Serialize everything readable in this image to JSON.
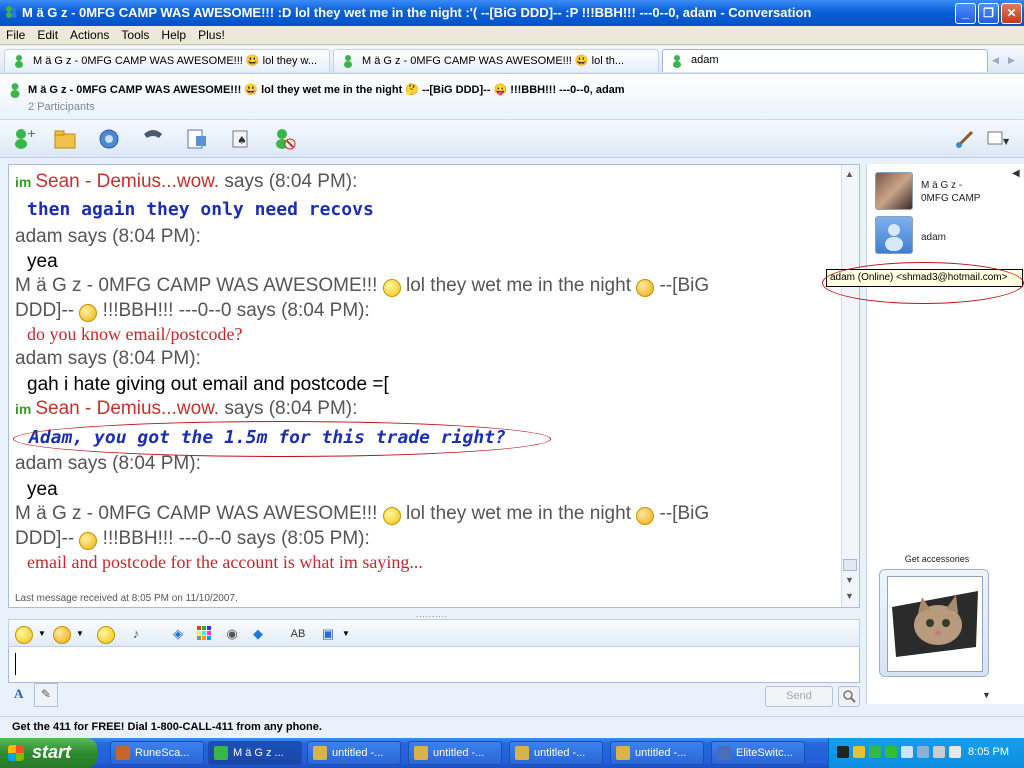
{
  "window": {
    "title": "M ä G z -      0MFG CAMP WAS AWESOME!!! :D lol they wet me in the night :'( --[BiG DDD]--     :P !!!BBH!!! ---0--0, adam - Conversation",
    "minimize": "_",
    "maximize": "❐",
    "close": "✕"
  },
  "menu": [
    "File",
    "Edit",
    "Actions",
    "Tools",
    "Help",
    "Plus!"
  ],
  "tabs": [
    {
      "label": "M ä G z -      0MFG CAMP WAS AWESOME!!! 😃 lol they w..."
    },
    {
      "label": "M ä G z -      0MFG CAMP WAS AWESOME!!! 😃 lol th..."
    },
    {
      "label": "adam"
    }
  ],
  "participants": {
    "names": "M ä G z -      0MFG CAMP WAS AWESOME!!! 😃 lol they wet me in the night 🤔 --[BiG DDD]--     😛 !!!BBH!!! ---0--0, adam",
    "count": "2 Participants"
  },
  "toolbar_icons": [
    "invite-contact-icon",
    "send-files-icon",
    "video-call-icon",
    "voice-call-icon",
    "activities-icon",
    "games-icon",
    "block-contact-icon",
    "paintbrush-icon",
    "display-options-icon"
  ],
  "messages": [
    {
      "im": "im",
      "sender": "Sean - Demius...wow.",
      "says": " says (8:04 PM):",
      "body": "then again they only need recovs"
    },
    {
      "sender": "adam",
      "says": " says (8:04 PM):",
      "body": "yea"
    },
    {
      "sender_a": "M ä  G z -      0MFG CAMP WAS AWESOME!!! ",
      "sender_b": " lol they wet me in the night ",
      "sender_c": " --[BiG",
      "sender_d": "DDD]--     ",
      "sender_e": " !!!BBH!!! ---0--0 says (8:04 PM):",
      "body": "do you know email/postcode?"
    },
    {
      "sender": "adam",
      "says": " says (8:04 PM):",
      "body": "gah i hate giving out email and postcode =["
    },
    {
      "im": "im",
      "sender": "Sean - Demius...wow.",
      "says": " says (8:04 PM):",
      "body": "Adam, you got the 1.5m for this trade right?"
    },
    {
      "sender": "adam",
      "says": " says (8:04 PM):",
      "body": "yea"
    },
    {
      "sender_a": "M ä  G z -      0MFG CAMP WAS AWESOME!!! ",
      "sender_b": " lol they wet me in the night ",
      "sender_c": " --[BiG",
      "sender_d": "DDD]--     ",
      "sender_e": " !!!BBH!!! ---0--0 says (8:05 PM):",
      "body": "email and postcode for the account is what im saying..."
    }
  ],
  "last_message": "Last message received at 8:05 PM on 11/10/2007.",
  "splitter": "..........",
  "input": {
    "send_label": "Send"
  },
  "contacts": [
    {
      "line1": "M ä G z -",
      "line2": "0MFG CAMP"
    },
    {
      "line1": "adam"
    }
  ],
  "tooltip": "adam (Online) <shmad3@hotmail.com>",
  "accessories_label": "Get accessories",
  "ad": "Get the 411 for FREE!  Dial 1-800-CALL-411 from any phone.",
  "taskbar": {
    "start": "start",
    "tasks": [
      "RuneSca...",
      "M ä G z ...",
      "untitled -...",
      "untitled -...",
      "untitled -...",
      "untitled -...",
      "EliteSwitc..."
    ],
    "clock": "8:05 PM"
  },
  "colors": {
    "accent": "#0553c6",
    "sender_red": "#c8302c",
    "body_blue": "#1b2fb5",
    "body_red": "#c8262b",
    "circle": "#c0141c"
  }
}
